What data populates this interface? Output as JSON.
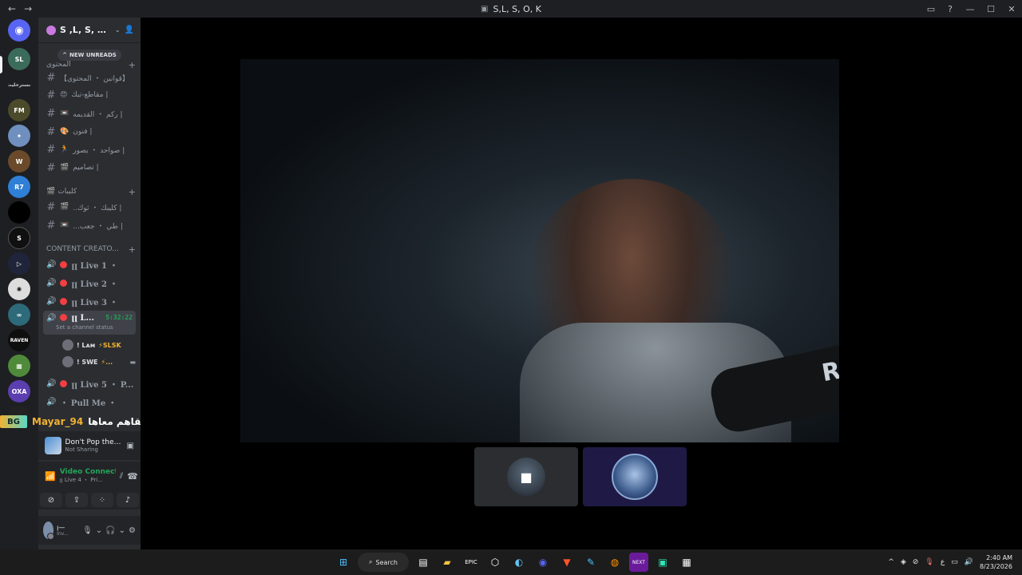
{
  "window": {
    "title": "S,L, S, O, K",
    "back_icon": "←",
    "forward_icon": "→"
  },
  "server": {
    "name": "S ,L, S, O,...",
    "new_unreads": "NEW UNREADS"
  },
  "categories": [
    {
      "label": "المحتوى",
      "id": "cat-content"
    },
    {
      "label": "كليبات",
      "id": "cat-clips"
    },
    {
      "label": "CONTENT CREATO...",
      "id": "cat-creators"
    }
  ],
  "text_channels": [
    {
      "label": "【قوانين ・ المحتوى】",
      "emoji": ""
    },
    {
      "label": "مقاطع-تبك |",
      "emoji": "😍"
    },
    {
      "label": "ركم ・ القديمه |",
      "emoji": "📼"
    },
    {
      "label": "فنون |",
      "emoji": "🎨"
    },
    {
      "label": "صواحد ・ يصور |",
      "emoji": "🏃"
    },
    {
      "label": "تصاميم |",
      "emoji": "🎬"
    }
  ],
  "clip_channels": [
    {
      "label": "..كليبك ・ ثوك |",
      "emoji": "🎬"
    },
    {
      "label": "...طي ・ جعب |",
      "emoji": "📼"
    }
  ],
  "voice_channels": [
    {
      "label": "ꞁꞁ Live 1 ・"
    },
    {
      "label": "ꞁꞁ Live 2 ・"
    },
    {
      "label": "ꞁꞁ Live 3 ・"
    },
    {
      "label": "ꞁꞁ L...",
      "timer": "5:32:22",
      "status": "Set a channel status"
    },
    {
      "label": "ꞁꞁ Live 5 ・ P..."
    },
    {
      "label": "・ Pull Me ・"
    }
  ],
  "voice_members": [
    {
      "name": "! Lᴀᴍ",
      "tag": "⚡SLSK"
    },
    {
      "name": "! SWE",
      "tag": "⚡..."
    }
  ],
  "caption": {
    "badge": "BG",
    "name": "Mayar_94",
    "text": "انا شلته وقلتله انقلع انل يتقاهم معاها"
  },
  "activity": {
    "title": "Don't Pop the Ballo...",
    "subtitle": "Not Sharing"
  },
  "voice_connection": {
    "title": "Video Connected",
    "subtitle": "ꞁꞁ Live 4 ・ Pri..."
  },
  "user": {
    "name": "ꞁ—",
    "status": "Inv..."
  },
  "video": {
    "brand_text": "RØDE"
  },
  "taskbar": {
    "search_label": "Search",
    "time": "2:40 AM",
    "date": "8/23/2026",
    "lang": "ع"
  },
  "colors": {
    "accent_green": "#23a55a",
    "live_red": "#f23f43",
    "caption_name": "#f0b232"
  }
}
